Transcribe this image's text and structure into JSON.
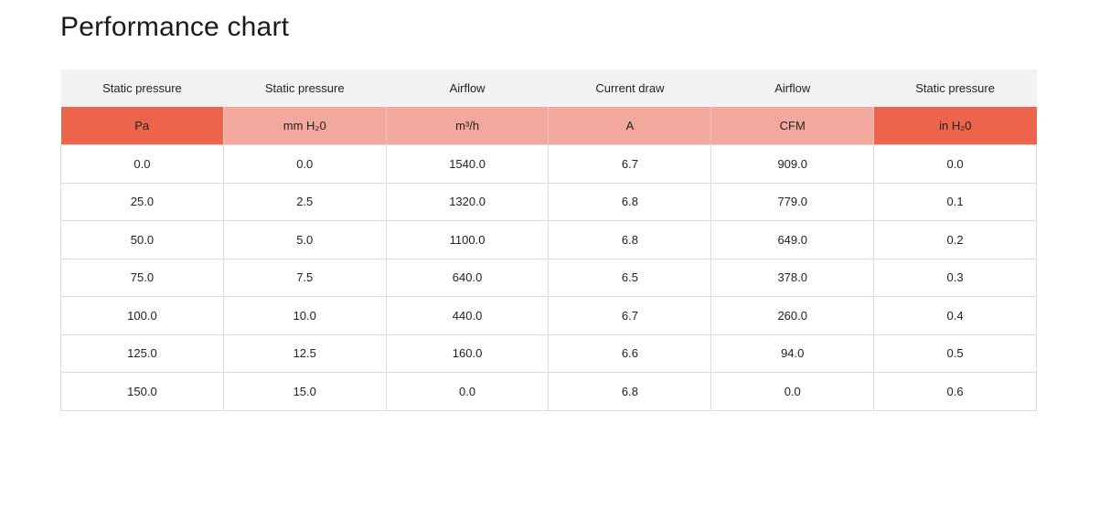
{
  "page": {
    "title": "Performance chart"
  },
  "table": {
    "columns": [
      {
        "label": "Static pressure",
        "unit": "Pa",
        "highlight": true
      },
      {
        "label": "Static pressure",
        "unit": "mm H₂0",
        "highlight": false
      },
      {
        "label": "Airflow",
        "unit": "m³/h",
        "highlight": false
      },
      {
        "label": "Current draw",
        "unit": "A",
        "highlight": false
      },
      {
        "label": "Airflow",
        "unit": "CFM",
        "highlight": false
      },
      {
        "label": "Static pressure",
        "unit": "in H₂0",
        "highlight": true
      }
    ],
    "rows": [
      [
        "0.0",
        "0.0",
        "1540.0",
        "6.7",
        "909.0",
        "0.0"
      ],
      [
        "25.0",
        "2.5",
        "1320.0",
        "6.8",
        "779.0",
        "0.1"
      ],
      [
        "50.0",
        "5.0",
        "1100.0",
        "6.8",
        "649.0",
        "0.2"
      ],
      [
        "75.0",
        "7.5",
        "640.0",
        "6.5",
        "378.0",
        "0.3"
      ],
      [
        "100.0",
        "10.0",
        "440.0",
        "6.7",
        "260.0",
        "0.4"
      ],
      [
        "125.0",
        "12.5",
        "160.0",
        "6.6",
        "94.0",
        "0.5"
      ],
      [
        "150.0",
        "15.0",
        "0.0",
        "6.8",
        "0.0",
        "0.6"
      ]
    ]
  },
  "colors": {
    "unit_highlight": "#ec644b",
    "unit_light": "#f2a89c",
    "header_bg": "#f2f2f2",
    "border": "#dcdcdc"
  }
}
